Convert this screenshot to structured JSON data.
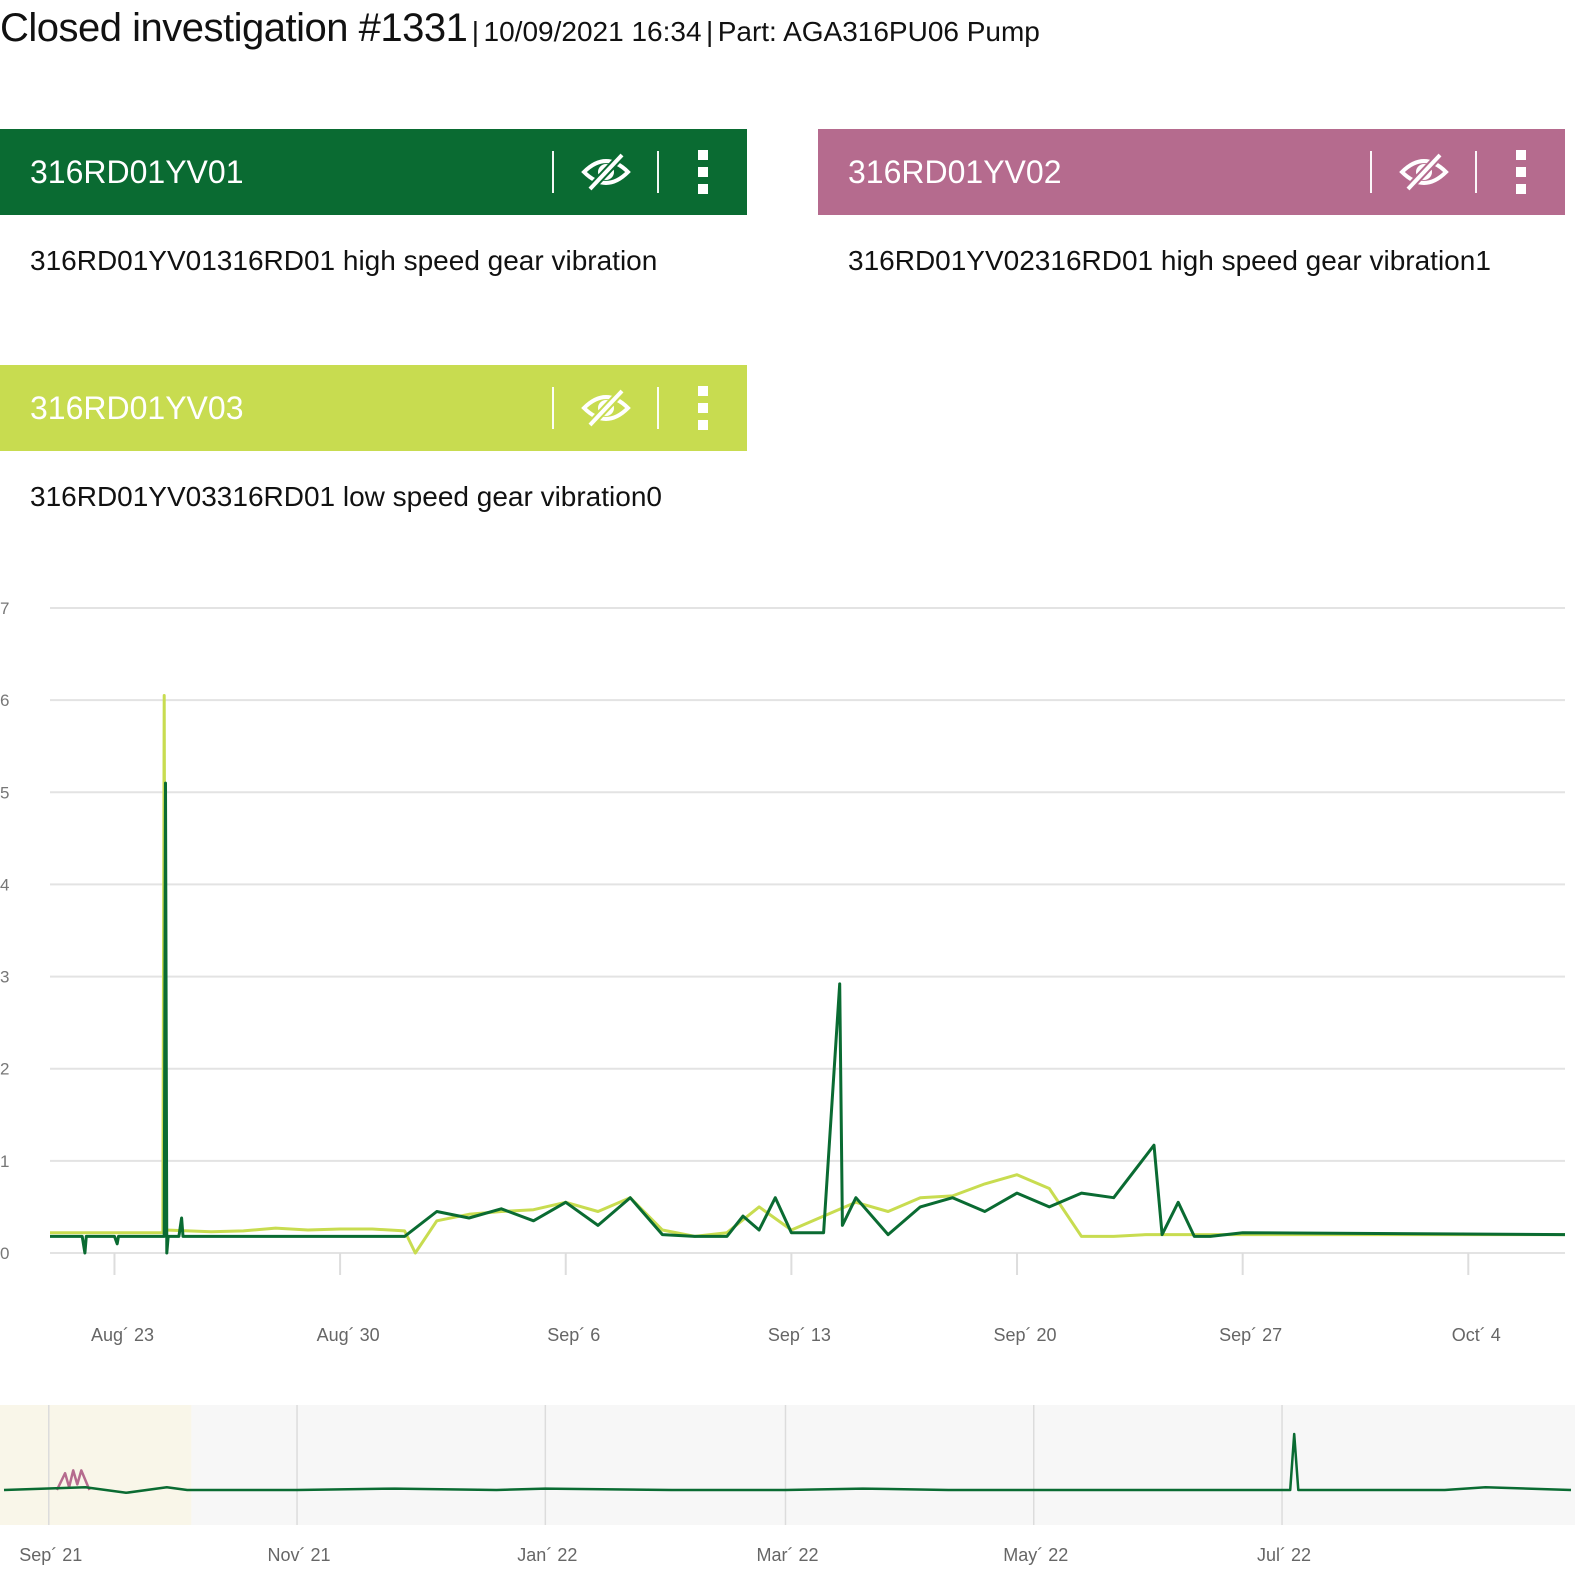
{
  "header": {
    "title": "Closed investigation #1331",
    "separator1": "|",
    "datetime": "10/09/2021 16:34",
    "separator2": "|",
    "part": "Part: AGA316PU06 Pump"
  },
  "sensors": [
    {
      "name": "316RD01YV01",
      "description": "316RD01YV01316RD01 high speed gear vibration",
      "color": "#0a6b32",
      "icon_visibility": "eye-off-icon",
      "icon_menu": "vertical-dots-icon"
    },
    {
      "name": "316RD01YV02",
      "description": "316RD01YV02316RD01 high speed gear vibration1",
      "color": "#b56b8e",
      "icon_visibility": "eye-off-icon",
      "icon_menu": "vertical-dots-icon"
    },
    {
      "name": "316RD01YV03",
      "description": "316RD01YV03316RD01 low speed gear vibration0",
      "color": "#c8dc50",
      "icon_visibility": "eye-off-icon",
      "icon_menu": "vertical-dots-icon"
    }
  ],
  "chart_data": [
    {
      "type": "line",
      "ylim": [
        0,
        7
      ],
      "yticks": [
        "0",
        "1",
        "2",
        "3",
        "4",
        "5",
        "6",
        "7"
      ],
      "xrange": [
        "2021-08-21",
        "2021-10-07"
      ],
      "xticks": [
        {
          "label": "Aug´ 23",
          "date": "2021-08-23"
        },
        {
          "label": "Aug´ 30",
          "date": "2021-08-30"
        },
        {
          "label": "Sep´ 6",
          "date": "2021-09-06"
        },
        {
          "label": "Sep´ 13",
          "date": "2021-09-13"
        },
        {
          "label": "Sep´ 20",
          "date": "2021-09-20"
        },
        {
          "label": "Sep´ 27",
          "date": "2021-09-27"
        },
        {
          "label": "Oct´ 4",
          "date": "2021-10-04"
        }
      ],
      "grid": true,
      "series": [
        {
          "color": "#c8dc50",
          "points": [
            [
              "2021-08-21",
              0.22
            ],
            [
              "2021-08-22",
              0.22
            ],
            [
              "2021-08-23",
              0.22
            ],
            [
              "2021-08-24",
              0.22
            ],
            [
              "2021-08-24T12",
              0.22
            ],
            [
              "2021-08-24T13",
              6.05
            ],
            [
              "2021-08-24T14",
              0.25
            ],
            [
              "2021-08-26",
              0.23
            ],
            [
              "2021-08-27",
              0.24
            ],
            [
              "2021-08-28",
              0.27
            ],
            [
              "2021-08-29",
              0.25
            ],
            [
              "2021-08-30",
              0.26
            ],
            [
              "2021-08-31",
              0.26
            ],
            [
              "2021-09-01",
              0.24
            ],
            [
              "2021-09-01T08",
              0.0
            ],
            [
              "2021-09-02",
              0.35
            ],
            [
              "2021-09-03",
              0.42
            ],
            [
              "2021-09-04",
              0.45
            ],
            [
              "2021-09-05",
              0.47
            ],
            [
              "2021-09-06",
              0.55
            ],
            [
              "2021-09-07",
              0.45
            ],
            [
              "2021-09-08",
              0.6
            ],
            [
              "2021-09-09",
              0.25
            ],
            [
              "2021-09-10",
              0.18
            ],
            [
              "2021-09-11",
              0.22
            ],
            [
              "2021-09-12",
              0.5
            ],
            [
              "2021-09-13",
              0.25
            ],
            [
              "2021-09-14",
              0.4
            ],
            [
              "2021-09-15",
              0.55
            ],
            [
              "2021-09-16",
              0.45
            ],
            [
              "2021-09-17",
              0.6
            ],
            [
              "2021-09-18",
              0.62
            ],
            [
              "2021-09-19",
              0.75
            ],
            [
              "2021-09-20",
              0.85
            ],
            [
              "2021-09-21",
              0.7
            ],
            [
              "2021-09-22",
              0.18
            ],
            [
              "2021-09-23",
              0.18
            ],
            [
              "2021-09-24",
              0.2
            ],
            [
              "2021-09-27",
              0.2
            ],
            [
              "2021-10-07",
              0.2
            ]
          ]
        },
        {
          "color": "#0a6b32",
          "points": [
            [
              "2021-08-21",
              0.18
            ],
            [
              "2021-08-22",
              0.18
            ],
            [
              "2021-08-22T02",
              0.0
            ],
            [
              "2021-08-22T03",
              0.18
            ],
            [
              "2021-08-23",
              0.18
            ],
            [
              "2021-08-23T02",
              0.1
            ],
            [
              "2021-08-23T03",
              0.18
            ],
            [
              "2021-08-24T13",
              0.18
            ],
            [
              "2021-08-24T14",
              5.1
            ],
            [
              "2021-08-24T15",
              0.0
            ],
            [
              "2021-08-24T16",
              0.18
            ],
            [
              "2021-08-25",
              0.18
            ],
            [
              "2021-08-25T02",
              0.38
            ],
            [
              "2021-08-25T03",
              0.18
            ],
            [
              "2021-09-01",
              0.18
            ],
            [
              "2021-09-02",
              0.45
            ],
            [
              "2021-09-03",
              0.38
            ],
            [
              "2021-09-04",
              0.48
            ],
            [
              "2021-09-05",
              0.35
            ],
            [
              "2021-09-06",
              0.55
            ],
            [
              "2021-09-07",
              0.3
            ],
            [
              "2021-09-08",
              0.6
            ],
            [
              "2021-09-09",
              0.2
            ],
            [
              "2021-09-10",
              0.18
            ],
            [
              "2021-09-11",
              0.18
            ],
            [
              "2021-09-11T12",
              0.4
            ],
            [
              "2021-09-12",
              0.25
            ],
            [
              "2021-09-12T12",
              0.6
            ],
            [
              "2021-09-13",
              0.22
            ],
            [
              "2021-09-14",
              0.22
            ],
            [
              "2021-09-14T12",
              2.92
            ],
            [
              "2021-09-14T14",
              0.3
            ],
            [
              "2021-09-15",
              0.6
            ],
            [
              "2021-09-16",
              0.2
            ],
            [
              "2021-09-17",
              0.5
            ],
            [
              "2021-09-18",
              0.6
            ],
            [
              "2021-09-19",
              0.45
            ],
            [
              "2021-09-20",
              0.65
            ],
            [
              "2021-09-21",
              0.5
            ],
            [
              "2021-09-22",
              0.65
            ],
            [
              "2021-09-23",
              0.6
            ],
            [
              "2021-09-24T06",
              1.17
            ],
            [
              "2021-09-24T12",
              0.2
            ],
            [
              "2021-09-25",
              0.55
            ],
            [
              "2021-09-25T12",
              0.18
            ],
            [
              "2021-09-26",
              0.18
            ],
            [
              "2021-09-27",
              0.22
            ],
            [
              "2021-10-07",
              0.2
            ]
          ]
        }
      ]
    },
    {
      "type": "line",
      "xrange": [
        "2021-08-21",
        "2022-09-10"
      ],
      "xticks": [
        {
          "label": "Sep´ 21",
          "date": "2021-09-01"
        },
        {
          "label": "Nov´ 21",
          "date": "2021-11-01"
        },
        {
          "label": "Jan´ 22",
          "date": "2022-01-01"
        },
        {
          "label": "Mar´ 22",
          "date": "2022-03-01"
        },
        {
          "label": "May´ 22",
          "date": "2022-05-01"
        },
        {
          "label": "Jul´ 22",
          "date": "2022-07-01"
        }
      ],
      "selected_range": [
        "2021-08-21",
        "2021-10-07"
      ],
      "series": [
        {
          "color": "#b56b8e",
          "points": [
            [
              "2021-09-03",
              0.0
            ],
            [
              "2021-09-05",
              0.6
            ],
            [
              "2021-09-06",
              0.1
            ],
            [
              "2021-09-07",
              0.7
            ],
            [
              "2021-09-08",
              0.2
            ],
            [
              "2021-09-09",
              0.7
            ],
            [
              "2021-09-11",
              0.0
            ]
          ]
        },
        {
          "color": "#0a6b32",
          "points": [
            [
              "2021-08-21",
              0.0
            ],
            [
              "2021-09-10",
              0.1
            ],
            [
              "2021-09-20",
              -0.1
            ],
            [
              "2021-09-30",
              0.1
            ],
            [
              "2021-10-05",
              0.0
            ],
            [
              "2021-11-01",
              0.0
            ],
            [
              "2021-11-25",
              0.05
            ],
            [
              "2021-12-20",
              0.0
            ],
            [
              "2022-01-01",
              0.05
            ],
            [
              "2022-02-01",
              0.0
            ],
            [
              "2022-03-01",
              0.0
            ],
            [
              "2022-03-20",
              0.05
            ],
            [
              "2022-04-10",
              0.0
            ],
            [
              "2022-05-01",
              0.0
            ],
            [
              "2022-06-01",
              0.0
            ],
            [
              "2022-07-03",
              0.0
            ],
            [
              "2022-07-04",
              2.0
            ],
            [
              "2022-07-05",
              0.0
            ],
            [
              "2022-08-10",
              0.0
            ],
            [
              "2022-08-20",
              0.1
            ],
            [
              "2022-09-10",
              0.0
            ]
          ]
        }
      ]
    }
  ]
}
